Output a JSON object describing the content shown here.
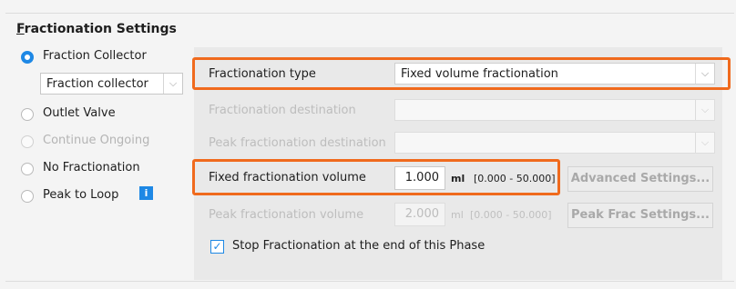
{
  "section": {
    "title_first": "F",
    "title_rest": "ractionation Settings"
  },
  "options": [
    {
      "label": "Fraction Collector",
      "state": "checked"
    },
    {
      "label": "Outlet Valve",
      "state": "normal"
    },
    {
      "label": "Continue Ongoing",
      "state": "disabled"
    },
    {
      "label": "No Fractionation",
      "state": "normal"
    },
    {
      "label": "Peak to Loop",
      "state": "normal"
    }
  ],
  "fraction_collector_select": {
    "value": "Fraction collector",
    "arrow": "⌵"
  },
  "info_icon": {
    "glyph": "i",
    "name": "info-icon"
  },
  "fields": {
    "fractionation_type": {
      "label": "Fractionation type",
      "value": "Fixed volume fractionation"
    },
    "fractionation_destination": {
      "label": "Fractionation destination",
      "value": ""
    },
    "peak_fractionation_destination": {
      "label": "Peak fractionation destination",
      "value": ""
    },
    "fixed_fractionation_volume": {
      "label": "Fixed fractionation volume",
      "value": "1.000",
      "unit": "ml",
      "range": "[0.000 - 50.000]"
    },
    "peak_fractionation_volume": {
      "label": "Peak fractionation volume",
      "value": "2.000",
      "unit": "ml",
      "range": "[0.000 - 50.000]"
    }
  },
  "buttons": {
    "advanced_settings": "Advanced Settings...",
    "peak_frac_settings": "Peak Frac Settings..."
  },
  "stop_checkbox": {
    "label": "Stop Fractionation at the end of this Phase",
    "checked": true,
    "mark": "✓"
  },
  "colors": {
    "accent": "#1e88e5",
    "highlight": "#f06a1d",
    "panel": "#e9e9e9"
  }
}
